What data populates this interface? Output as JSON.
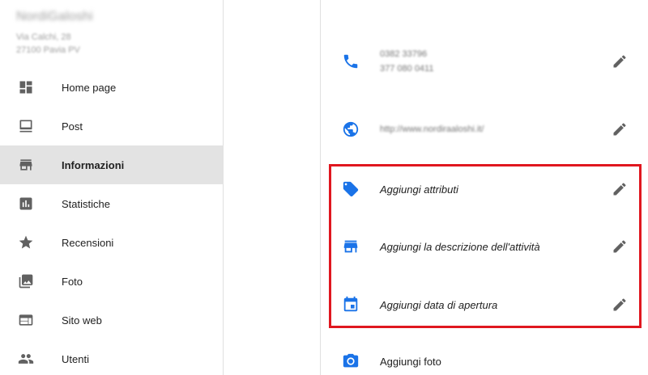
{
  "business": {
    "name": "NordiGaloshi",
    "address_line1": "Via Calchi, 28",
    "address_line2": "27100 Pavia PV"
  },
  "sidebar": {
    "items": [
      {
        "label": "Home page",
        "icon": "dashboard-icon"
      },
      {
        "label": "Post",
        "icon": "post-icon"
      },
      {
        "label": "Informazioni",
        "icon": "store-icon",
        "active": true
      },
      {
        "label": "Statistiche",
        "icon": "insights-icon"
      },
      {
        "label": "Recensioni",
        "icon": "star-icon"
      },
      {
        "label": "Foto",
        "icon": "photo-library-icon"
      },
      {
        "label": "Sito web",
        "icon": "web-icon"
      },
      {
        "label": "Utenti",
        "icon": "people-icon"
      }
    ]
  },
  "info": {
    "phone_primary": "0382 33796",
    "phone_secondary": "377 080 0411",
    "website": "http://www.nordiraaloshi.it/",
    "add_attributes": "Aggiungi attributi",
    "add_description": "Aggiungi la descrizione dell'attività",
    "add_opening_date": "Aggiungi data di apertura",
    "add_photo": "Aggiungi foto"
  },
  "colors": {
    "accent_blue": "#1a73e8",
    "icon_grey": "#616161",
    "highlight_red": "#e0171f"
  }
}
